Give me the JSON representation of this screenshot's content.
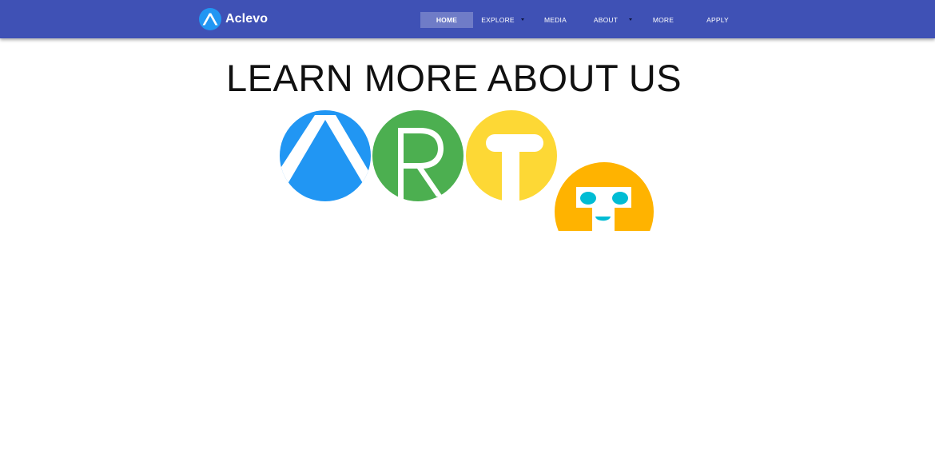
{
  "brand": {
    "name": "Aclevo",
    "logo_icon": "triangle-circle-logo-icon"
  },
  "nav": {
    "items": [
      {
        "label": "HOME",
        "active": true,
        "has_dropdown": false
      },
      {
        "label": "EXPLORE",
        "active": false,
        "has_dropdown": true
      },
      {
        "label": "MEDIA",
        "active": false,
        "has_dropdown": false
      },
      {
        "label": "ABOUT",
        "active": false,
        "has_dropdown": true
      },
      {
        "label": "MORE",
        "active": false,
        "has_dropdown": false
      },
      {
        "label": "APPLY",
        "active": false,
        "has_dropdown": false
      }
    ]
  },
  "main": {
    "headline": "LEARN MORE ABOUT US",
    "art_logo": {
      "icon": "art-logo-icon",
      "letters": [
        "A",
        "R",
        "T"
      ]
    }
  },
  "colors": {
    "navbar": "#3f51b5",
    "active_nav_bg": "#6a77c8",
    "blue": "#2196f3",
    "green": "#4caf50",
    "yellow": "#fdd835",
    "orange": "#ffb300",
    "teal": "#00bcd4"
  }
}
